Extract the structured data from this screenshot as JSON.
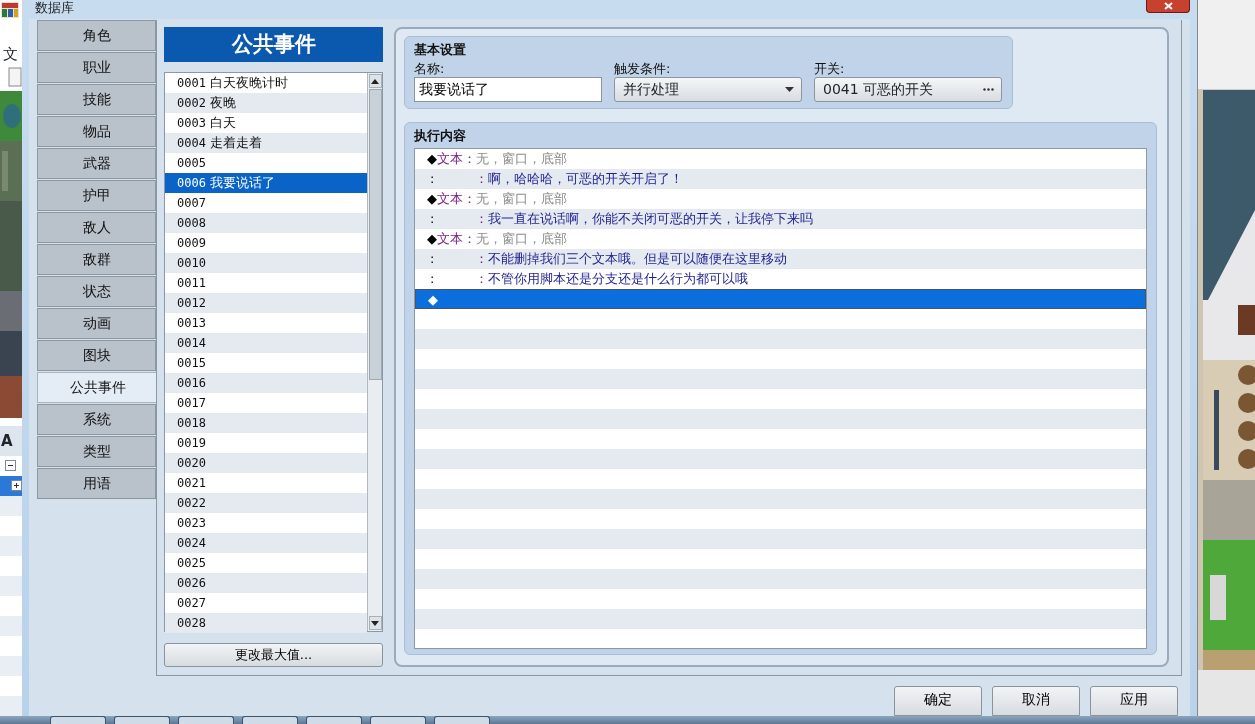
{
  "window": {
    "title": "数据库"
  },
  "background_app": {
    "menu": "文",
    "label": "A"
  },
  "tabs": [
    {
      "label": "角色",
      "selected": false
    },
    {
      "label": "职业",
      "selected": false
    },
    {
      "label": "技能",
      "selected": false
    },
    {
      "label": "物品",
      "selected": false
    },
    {
      "label": "武器",
      "selected": false
    },
    {
      "label": "护甲",
      "selected": false
    },
    {
      "label": "敌人",
      "selected": false
    },
    {
      "label": "敌群",
      "selected": false
    },
    {
      "label": "状态",
      "selected": false
    },
    {
      "label": "动画",
      "selected": false
    },
    {
      "label": "图块",
      "selected": false
    },
    {
      "label": "公共事件",
      "selected": true
    },
    {
      "label": "系统",
      "selected": false
    },
    {
      "label": "类型",
      "selected": false
    },
    {
      "label": "用语",
      "selected": false
    }
  ],
  "event_list": {
    "title": "公共事件",
    "items": [
      {
        "id": "0001",
        "name": "白天夜晚计时",
        "selected": false
      },
      {
        "id": "0002",
        "name": "夜晚",
        "selected": false
      },
      {
        "id": "0003",
        "name": "白天",
        "selected": false
      },
      {
        "id": "0004",
        "name": "走着走着",
        "selected": false
      },
      {
        "id": "0005",
        "selected": false
      },
      {
        "id": "0006",
        "name": "我要说话了",
        "selected": true
      },
      {
        "id": "0007",
        "selected": false
      },
      {
        "id": "0008",
        "selected": false
      },
      {
        "id": "0009",
        "selected": false
      },
      {
        "id": "0010",
        "selected": false
      },
      {
        "id": "0011",
        "selected": false
      },
      {
        "id": "0012",
        "selected": false
      },
      {
        "id": "0013",
        "selected": false
      },
      {
        "id": "0014",
        "selected": false
      },
      {
        "id": "0015",
        "selected": false
      },
      {
        "id": "0016",
        "selected": false
      },
      {
        "id": "0017",
        "selected": false
      },
      {
        "id": "0018",
        "selected": false
      },
      {
        "id": "0019",
        "selected": false
      },
      {
        "id": "0020",
        "selected": false
      },
      {
        "id": "0021",
        "selected": false
      },
      {
        "id": "0022",
        "selected": false
      },
      {
        "id": "0023",
        "selected": false
      },
      {
        "id": "0024",
        "selected": false
      },
      {
        "id": "0025",
        "selected": false
      },
      {
        "id": "0026",
        "selected": false
      },
      {
        "id": "0027",
        "selected": false
      },
      {
        "id": "0028",
        "selected": false
      }
    ],
    "button": "更改最大值..."
  },
  "general": {
    "title": "基本设置",
    "name_label": "名称:",
    "name_value": "我要说话了",
    "trigger_label": "触发条件:",
    "trigger_value": "并行处理",
    "switch_label": "开关:",
    "switch_value": "0041 可恶的开关"
  },
  "contents": {
    "title": "执行内容",
    "commands": [
      {
        "kind": "header",
        "marker": "◆",
        "label": "文本",
        "separator": "：",
        "text": "无，窗口，底部",
        "selected": false
      },
      {
        "kind": "line",
        "marker": ":",
        "separator": "：",
        "text": "啊，哈哈哈，可恶的开关开启了！",
        "selected": false
      },
      {
        "kind": "header",
        "marker": "◆",
        "label": "文本",
        "separator": "：",
        "text": "无，窗口，底部",
        "selected": false
      },
      {
        "kind": "line",
        "marker": ":",
        "separator": "：",
        "text": "我一直在说话啊，你能不关闭可恶的开关，让我停下来吗",
        "selected": false
      },
      {
        "kind": "header",
        "marker": "◆",
        "label": "文本",
        "separator": "：",
        "text": "无，窗口，底部",
        "selected": false
      },
      {
        "kind": "line",
        "marker": ":",
        "separator": "：",
        "text": "不能删掉我们三个文本哦。但是可以随便在这里移动",
        "selected": false
      },
      {
        "kind": "line",
        "marker": ":",
        "separator": "：",
        "text": "不管你用脚本还是分支还是什么行为都可以哦",
        "selected": false
      },
      {
        "kind": "end",
        "marker": "◆",
        "selected": true
      }
    ]
  },
  "buttons": [
    "确定",
    "取消",
    "应用"
  ]
}
